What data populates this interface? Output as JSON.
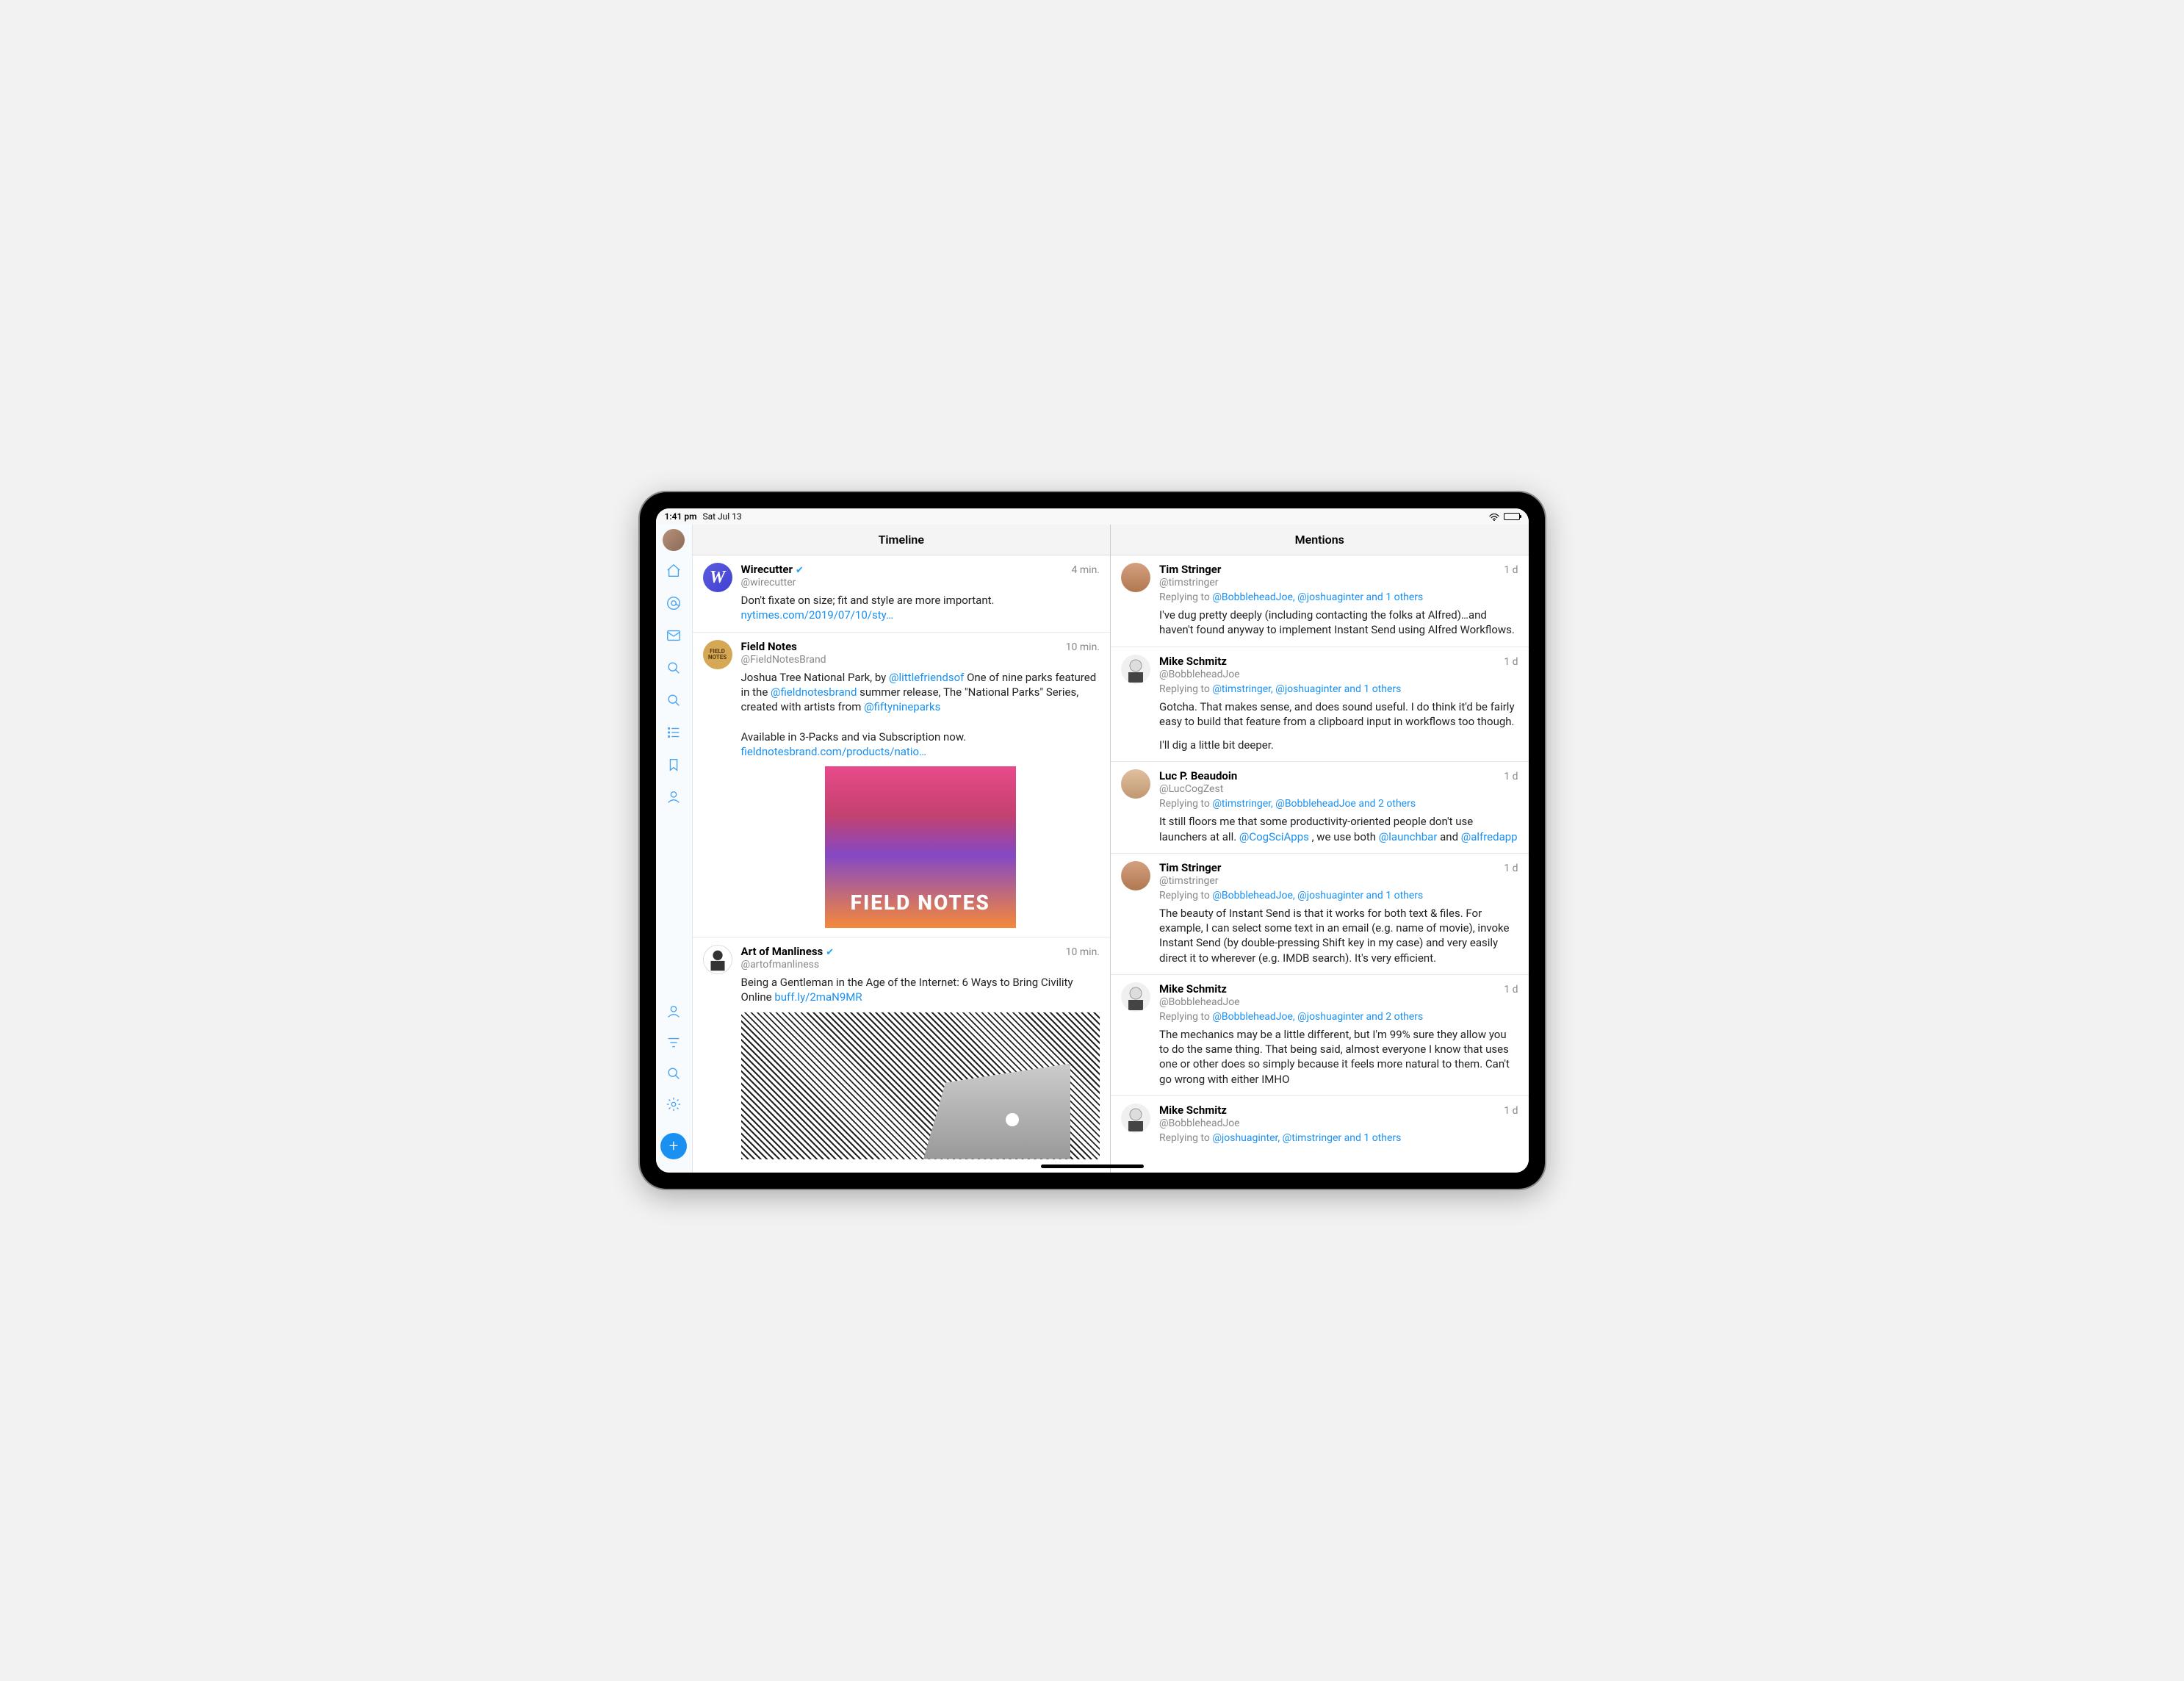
{
  "status": {
    "time": "1:41 pm",
    "date": "Sat Jul 13"
  },
  "columns": {
    "timeline": {
      "title": "Timeline"
    },
    "mentions": {
      "title": "Mentions"
    }
  },
  "timeline": [
    {
      "name": "Wirecutter",
      "handle": "@wirecutter",
      "verified": true,
      "time": "4 min.",
      "text_pre": "Don't fixate on size; fit and style are more important. ",
      "link": "nytimes.com/2019/07/10/sty…",
      "avatar": "W"
    },
    {
      "name": "Field Notes",
      "handle": "@FieldNotesBrand",
      "verified": false,
      "time": "10 min.",
      "avatar": "FIELD NOTES",
      "segments": {
        "t1": "Joshua Tree National Park, by ",
        "l1": "@littlefriendsof",
        "t2": " One of nine parks featured in the ",
        "l2": "@fieldnotesbrand",
        "t3": " summer release, The \"National Parks\" Series, created with artists from ",
        "l3": "@fiftynineparks",
        "t4": "Available in 3-Packs and via Subscription now.",
        "l4": "fieldnotesbrand.com/products/natio…"
      },
      "image_label": "FIELD NOTES"
    },
    {
      "name": "Art of Manliness",
      "handle": "@artofmanliness",
      "verified": true,
      "time": "10 min.",
      "segments": {
        "t1": "Being a Gentleman in the Age of the Internet: 6 Ways to Bring Civility Online ",
        "l1": "buff.ly/2maN9MR"
      }
    }
  ],
  "mentions": [
    {
      "name": "Tim Stringer",
      "handle": "@timstringer",
      "time": "1 d",
      "reply_prefix": "Replying to ",
      "reply_to": "@BobbleheadJoe, @joshuaginter and 1 others",
      "text": "I've dug pretty deeply (including contacting the folks at Alfred)…and haven't found anyway to implement Instant Send using Alfred Workflows.",
      "avatar": "tim"
    },
    {
      "name": "Mike Schmitz",
      "handle": "@BobbleheadJoe",
      "time": "1 d",
      "reply_prefix": "Replying to ",
      "reply_to": "@timstringer, @joshuaginter and 1 others",
      "text": "Gotcha. That makes sense, and does sound useful. I do think it'd be fairly easy to build that feature from a clipboard input in workflows too though.",
      "text2": "I'll dig a little bit deeper.",
      "avatar": "mike"
    },
    {
      "name": "Luc P. Beaudoin",
      "handle": "@LucCogZest",
      "time": "1 d",
      "reply_prefix": "Replying to ",
      "reply_to": "@timstringer, @BobbleheadJoe and 2 others",
      "segments": {
        "t1": "It still floors me that some productivity-oriented people don't use launchers at all.  ",
        "l1": "@CogSciApps",
        "t2": " , we use both ",
        "l2": "@launchbar",
        "t3": " and ",
        "l3": "@alfredapp"
      },
      "avatar": "luc"
    },
    {
      "name": "Tim Stringer",
      "handle": "@timstringer",
      "time": "1 d",
      "reply_prefix": "Replying to ",
      "reply_to": "@BobbleheadJoe, @joshuaginter and 1 others",
      "text": "The beauty of Instant Send is that it works for both text & files. For example, I can select some text in an email (e.g. name of movie), invoke Instant Send (by double-pressing Shift key in my case) and very easily direct it to wherever (e.g. IMDB search). It's very efficient.",
      "avatar": "tim"
    },
    {
      "name": "Mike Schmitz",
      "handle": "@BobbleheadJoe",
      "time": "1 d",
      "reply_prefix": "Replying to ",
      "reply_to": "@BobbleheadJoe, @joshuaginter and 2 others",
      "text": "The mechanics may be a little different, but I'm 99% sure they allow you to do the same thing. That being said, almost everyone I know that uses one or other does so simply because it feels more natural to them. Can't go wrong with either IMHO",
      "avatar": "mike"
    },
    {
      "name": "Mike Schmitz",
      "handle": "@BobbleheadJoe",
      "time": "1 d",
      "reply_prefix": "Replying to ",
      "reply_to": "@joshuaginter, @timstringer and 1 others",
      "avatar": "mike"
    }
  ]
}
